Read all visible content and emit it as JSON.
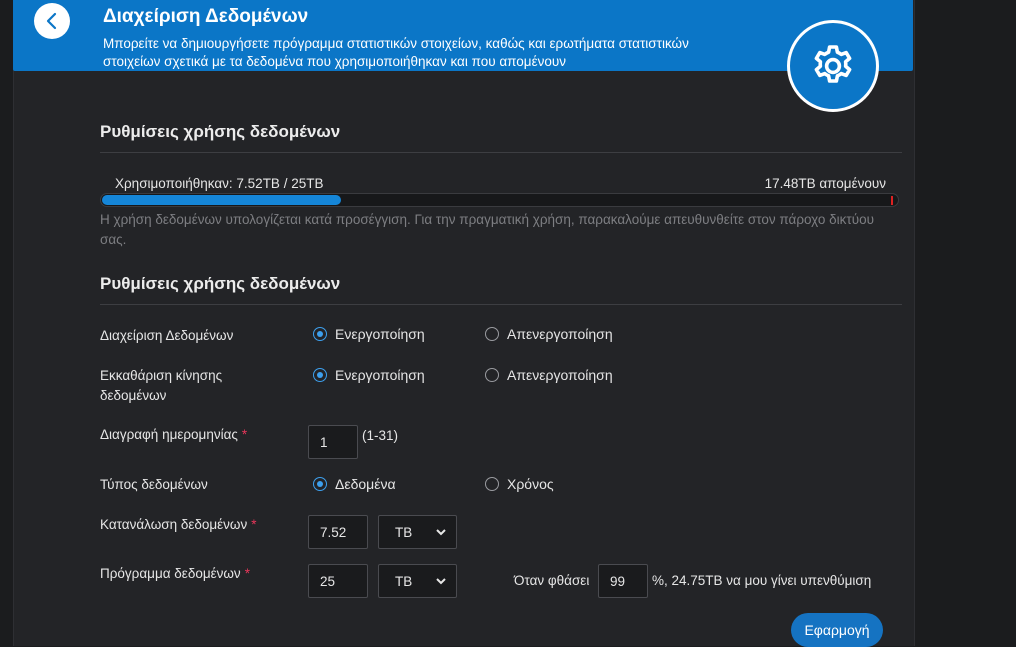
{
  "header": {
    "title": "Διαχείριση Δεδομένων",
    "description": "Μπορείτε να δημιουργήσετε πρόγραμμα στατιστικών στοιχείων, καθώς και ερωτήματα στατιστικών στοιχείων σχετικά με τα δεδομένα που χρησιμοποιήθηκαν και που απομένουν",
    "back_icon": "chevron-left-icon",
    "settings_icon": "gear-icon",
    "accent_color": "#0b76c7"
  },
  "usage": {
    "section_title": "Ρυθμίσεις χρήσης δεδομένων",
    "used_label": "Χρησιμοποιήθηκαν: 7.52TB / 25TB",
    "remaining_label": "17.48TB απομένουν",
    "used_fraction": 0.3,
    "note": "Η χρήση δεδομένων υπολογίζεται κατά προσέγγιση. Για την πραγματική χρήση, παρακαλούμε απευθυνθείτε στον πάροχο δικτύου σας."
  },
  "settings": {
    "section_title": "Ρυθμίσεις χρήσης δεδομένων",
    "data_management": {
      "label": "Διαχείριση Δεδομένων",
      "options": [
        "Ενεργοποίηση",
        "Απενεργοποίηση"
      ],
      "selected": 0
    },
    "clear_traffic": {
      "label_line1": "Εκκαθάριση κίνησης",
      "label_line2": "δεδομένων",
      "options": [
        "Ενεργοποίηση",
        "Απενεργοποίηση"
      ],
      "selected": 0
    },
    "reset_date": {
      "label": "Διαγραφή ημερομηνίας",
      "required_mark": "*",
      "value": "1",
      "range_hint": "(1-31)"
    },
    "data_type": {
      "label": "Τύπος δεδομένων",
      "options": [
        "Δεδομένα",
        "Χρόνος"
      ],
      "selected": 0
    },
    "consumption": {
      "label": "Κατανάλωση δεδομένων",
      "required_mark": "*",
      "value": "7.52",
      "unit": "TB"
    },
    "plan": {
      "label": "Πρόγραμμα δεδομένων",
      "required_mark": "*",
      "value": "25",
      "unit": "TB",
      "reminder_prefix": "Όταν φθάσει",
      "reminder_value": "99",
      "reminder_suffix": "%, 24.75TB να μου γίνει υπενθύμιση"
    },
    "apply_label": "Εφαρμογή"
  }
}
